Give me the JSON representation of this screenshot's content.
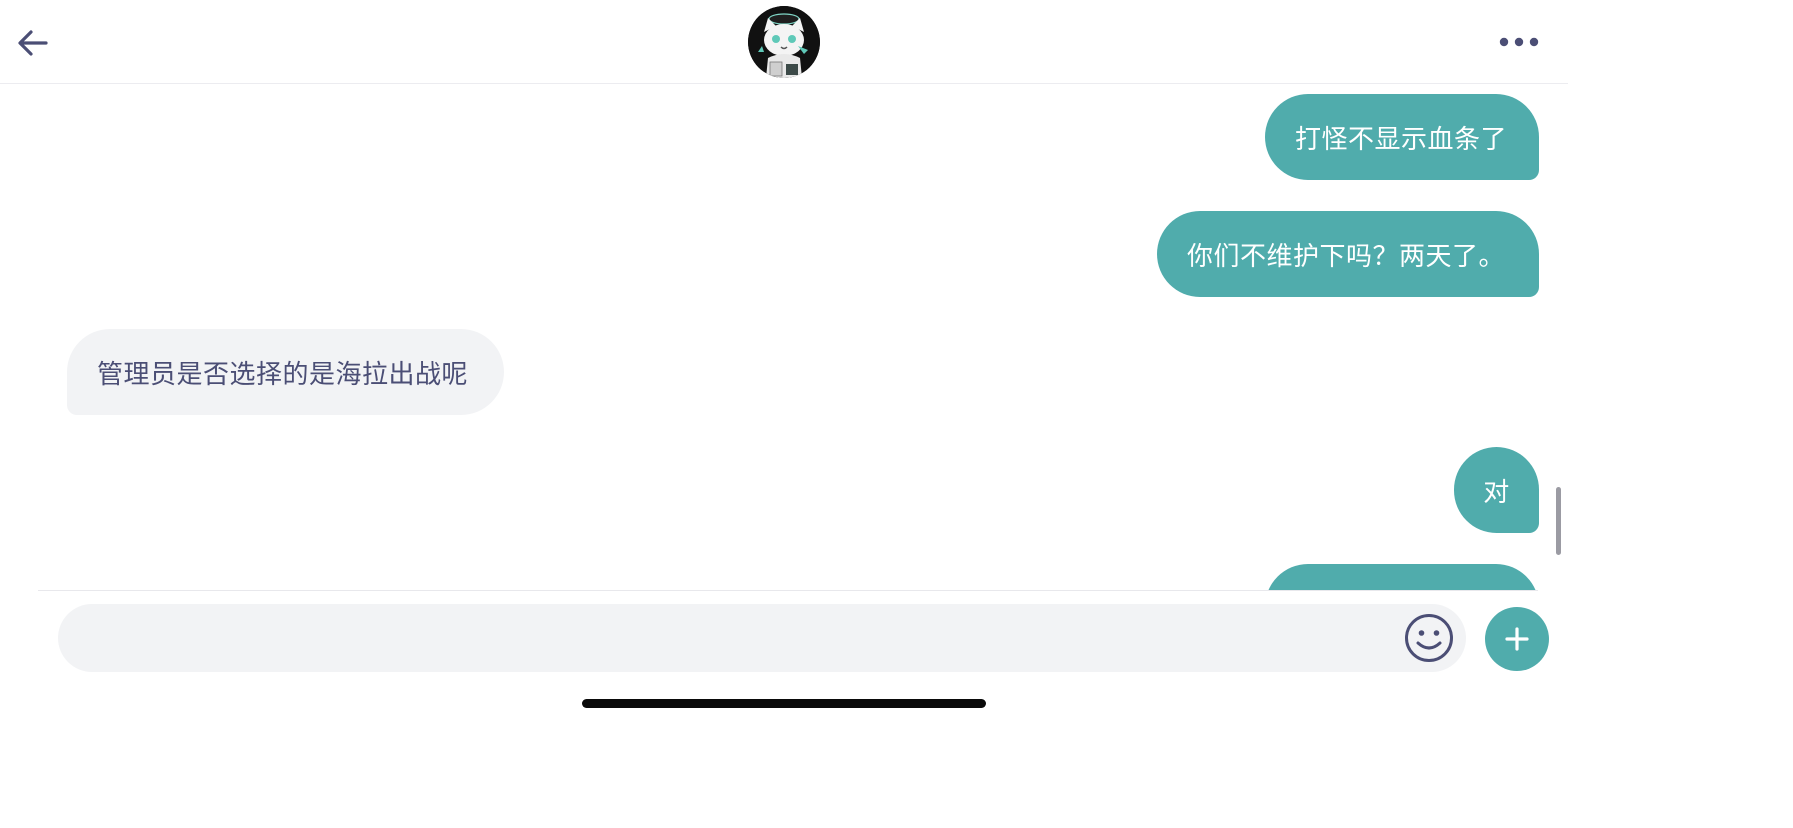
{
  "header": {
    "back_icon": "arrow-left-icon",
    "avatar_icon": "cat-avatar-icon",
    "more_icon": "more-horizontal-icon"
  },
  "messages": [
    {
      "direction": "outgoing",
      "text": "打怪不显示血条了"
    },
    {
      "direction": "outgoing",
      "text": "你们不维护下吗？两天了。"
    },
    {
      "direction": "incoming",
      "text": "管理员是否选择的是海拉出战呢"
    },
    {
      "direction": "outgoing",
      "text": "对"
    },
    {
      "direction": "outgoing",
      "text": ""
    }
  ],
  "composer": {
    "value": "",
    "placeholder": "",
    "emoji_icon": "smiley-icon",
    "plus_icon": "plus-icon"
  },
  "colors": {
    "accent": "#50acac",
    "incoming_bubble": "#f2f3f5",
    "incoming_text": "#4b4e75",
    "icon": "#4b4e75"
  }
}
